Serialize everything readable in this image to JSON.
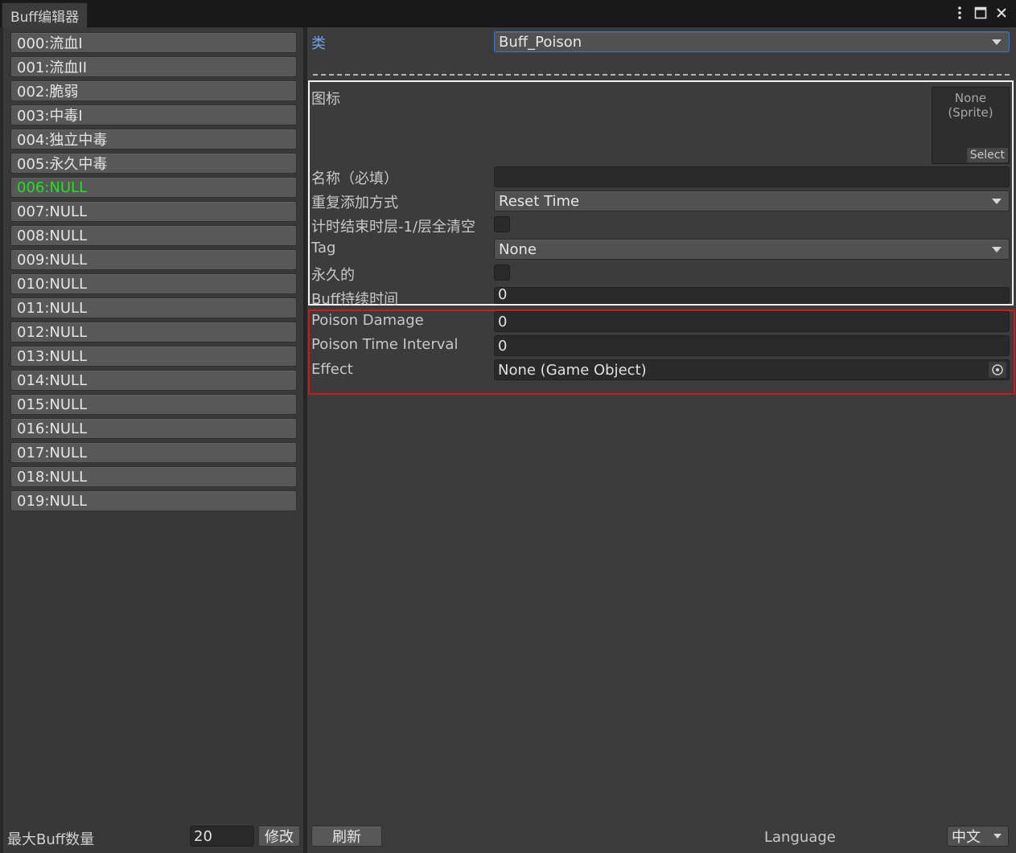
{
  "window": {
    "tab_title": "Buff编辑器",
    "menu_icon": "kebab-menu-icon",
    "maximize_icon": "maximize-icon",
    "close_icon": "close-icon"
  },
  "buff_list": [
    {
      "label": "000:流血I",
      "active": false
    },
    {
      "label": "001:流血II",
      "active": false
    },
    {
      "label": "002:脆弱",
      "active": false
    },
    {
      "label": "003:中毒I",
      "active": false
    },
    {
      "label": "004:独立中毒",
      "active": false
    },
    {
      "label": "005:永久中毒",
      "active": false
    },
    {
      "label": "006:NULL",
      "active": true
    },
    {
      "label": "007:NULL",
      "active": false
    },
    {
      "label": "008:NULL",
      "active": false
    },
    {
      "label": "009:NULL",
      "active": false
    },
    {
      "label": "010:NULL",
      "active": false
    },
    {
      "label": "011:NULL",
      "active": false
    },
    {
      "label": "012:NULL",
      "active": false
    },
    {
      "label": "013:NULL",
      "active": false
    },
    {
      "label": "014:NULL",
      "active": false
    },
    {
      "label": "015:NULL",
      "active": false
    },
    {
      "label": "016:NULL",
      "active": false
    },
    {
      "label": "017:NULL",
      "active": false
    },
    {
      "label": "018:NULL",
      "active": false
    },
    {
      "label": "019:NULL",
      "active": false
    }
  ],
  "left_footer": {
    "max_label": "最大Buff数量",
    "max_value": "20",
    "modify_button": "修改"
  },
  "inspector": {
    "class_label": "类",
    "class_value": "Buff_Poison",
    "icon_label": "图标",
    "sprite_text_line1": "None",
    "sprite_text_line2": "(Sprite)",
    "sprite_select": "Select",
    "name_label": "名称（必填）",
    "name_value": "",
    "repeat_label": "重复添加方式",
    "repeat_value": "Reset Time",
    "timer_label": "计时结束时层-1/层全清空",
    "tag_label": "Tag",
    "tag_value": "None",
    "permanent_label": "永久的",
    "duration_label": "Buff持续时间",
    "duration_value": "0",
    "poison_damage_label": "Poison Damage",
    "poison_damage_value": "0",
    "poison_interval_label": "Poison Time Interval",
    "poison_interval_value": "0",
    "effect_label": "Effect",
    "effect_value": "None (Game Object)"
  },
  "right_footer": {
    "refresh_button": "刷新",
    "language_label": "Language",
    "language_value": "中文"
  },
  "colors": {
    "active_item": "#22e022",
    "class_label": "#6fa3ea",
    "highlight_white": "#f2f2f2",
    "highlight_red": "#d01818"
  }
}
